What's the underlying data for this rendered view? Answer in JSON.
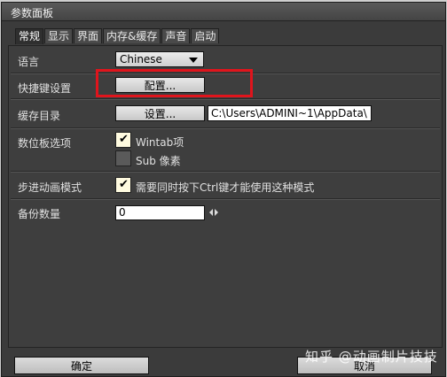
{
  "window": {
    "title": "参数面板"
  },
  "tabs": [
    "常规",
    "显示",
    "界面",
    "内存&缓存",
    "声音",
    "启动"
  ],
  "settings": {
    "language": {
      "label": "语言",
      "value": "Chinese"
    },
    "shortcut": {
      "label": "快捷键设置",
      "button": "配置..."
    },
    "cache": {
      "label": "缓存目录",
      "button": "设置...",
      "path": "C:\\Users\\ADMINI~1\\AppData\\"
    },
    "tablet": {
      "label": "数位板选项",
      "wintab": "Wintab项",
      "sub_pixel": "Sub 像素"
    },
    "step_animation": {
      "label": "步进动画模式",
      "option": "需要同时按下Ctrl键才能使用这种模式"
    },
    "backup": {
      "label": "备份数量",
      "value": "0"
    }
  },
  "footer": {
    "ok": "确定",
    "cancel": "取消"
  },
  "watermark": "知乎 @动画制片技技",
  "colors": {
    "highlight": "#e0141c",
    "panel": "#3e3e3e"
  }
}
